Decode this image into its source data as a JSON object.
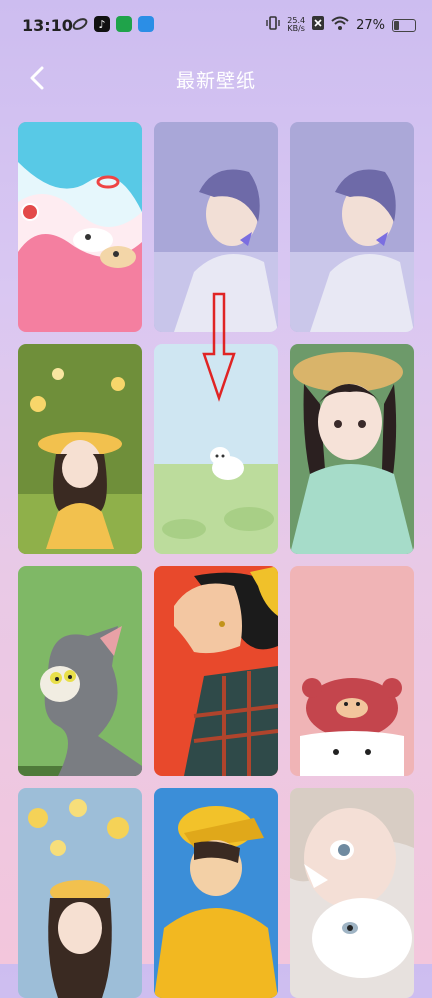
{
  "status": {
    "time": "13:10",
    "net_speed_value": "25.4",
    "net_speed_unit": "KB/s",
    "battery_text": "27%",
    "battery_level": 0.27
  },
  "header": {
    "title": "最新壁纸",
    "back_icon": "chevron-left-icon"
  },
  "wallpapers": [
    {
      "id": "beach-dogs",
      "theme": "pink beach with puppies"
    },
    {
      "id": "girl-butterfly-1",
      "theme": "lavender girl with butterfly"
    },
    {
      "id": "girl-butterfly-2",
      "theme": "lavender girl with butterfly"
    },
    {
      "id": "girl-flowers",
      "theme": "girl in yellow flower hat"
    },
    {
      "id": "puppy-meadow",
      "theme": "puppy in green meadow"
    },
    {
      "id": "girl-straw-hat",
      "theme": "girl with straw hat"
    },
    {
      "id": "cartoon-cat",
      "theme": "cartoon grey cat on green"
    },
    {
      "id": "profile-red",
      "theme": "profile portrait on red"
    },
    {
      "id": "bear-hat",
      "theme": "bear hat character on pink"
    },
    {
      "id": "girl-yellow-flowers",
      "theme": "girl under yellow blossoms"
    },
    {
      "id": "boy-yellow-cap",
      "theme": "boy in yellow cap"
    },
    {
      "id": "girl-white-cat",
      "theme": "girl with white cat"
    }
  ]
}
